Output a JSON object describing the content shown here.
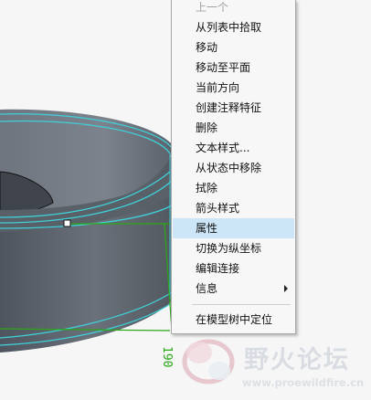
{
  "context_menu": {
    "items": [
      {
        "label": "上一个",
        "enabled": false
      },
      {
        "label": "从列表中拾取"
      },
      {
        "label": "移动"
      },
      {
        "label": "移动至平面"
      },
      {
        "label": "当前方向"
      },
      {
        "label": "创建注释特征"
      },
      {
        "label": "删除"
      },
      {
        "label": "文本样式..."
      },
      {
        "label": "从状态中移除"
      },
      {
        "label": "拭除"
      },
      {
        "label": "箭头样式"
      },
      {
        "label": "属性",
        "highlighted": true
      },
      {
        "label": "切换为纵坐标"
      },
      {
        "label": "编辑连接"
      },
      {
        "label": "信息",
        "has_submenu": true
      },
      {
        "label": "在模型树中定位"
      }
    ]
  },
  "dimension": {
    "text": "190",
    "color": "#2aa818"
  },
  "model": {
    "body_color": "#676d77",
    "edge_color": "#3fd0d8"
  },
  "watermark": {
    "title": "野火论坛",
    "url": "www.proewildfire.cn"
  }
}
